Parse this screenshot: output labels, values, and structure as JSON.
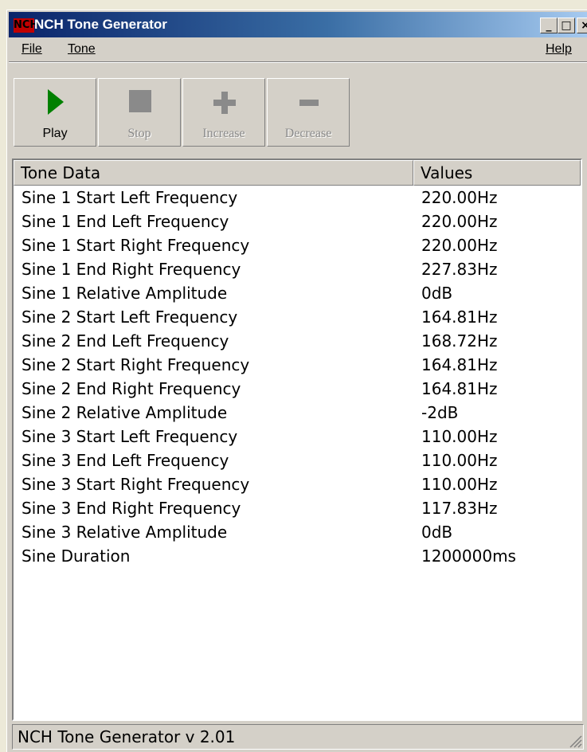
{
  "window": {
    "title": "NCH Tone Generator",
    "logo": "NCH"
  },
  "title_buttons": {
    "minimize": "_",
    "maximize": "□",
    "close": "×"
  },
  "menu": {
    "file": "File",
    "tone": "Tone",
    "help": "Help"
  },
  "toolbar": {
    "play": "Play",
    "stop": "Stop",
    "increase": "Increase",
    "decrease": "Decrease"
  },
  "colors": {
    "play_icon": "#008000",
    "disabled_icon": "#8a8a8a",
    "title_start": "#0a246a",
    "title_end": "#a6caf0"
  },
  "table": {
    "headers": [
      "Tone Data",
      "Values"
    ],
    "rows": [
      [
        "Sine 1 Start Left Frequency",
        "220.00Hz"
      ],
      [
        "Sine 1 End Left Frequency",
        "220.00Hz"
      ],
      [
        "Sine 1 Start Right Frequency",
        "220.00Hz"
      ],
      [
        "Sine 1 End Right Frequency",
        "227.83Hz"
      ],
      [
        "Sine 1 Relative Amplitude",
        "0dB"
      ],
      [
        "Sine 2 Start Left Frequency",
        "164.81Hz"
      ],
      [
        "Sine 2 End Left Frequency",
        "168.72Hz"
      ],
      [
        "Sine 2 Start Right Frequency",
        "164.81Hz"
      ],
      [
        "Sine 2 End Right Frequency",
        "164.81Hz"
      ],
      [
        "Sine 2 Relative Amplitude",
        "-2dB"
      ],
      [
        "Sine 3 Start Left Frequency",
        "110.00Hz"
      ],
      [
        "Sine 3 End Left Frequency",
        "110.00Hz"
      ],
      [
        "Sine 3 Start Right Frequency",
        "110.00Hz"
      ],
      [
        "Sine 3 End Right Frequency",
        "117.83Hz"
      ],
      [
        "Sine 3 Relative Amplitude",
        "0dB"
      ],
      [
        "Sine Duration",
        "1200000ms"
      ]
    ]
  },
  "status": {
    "text": "NCH Tone Generator v 2.01"
  }
}
